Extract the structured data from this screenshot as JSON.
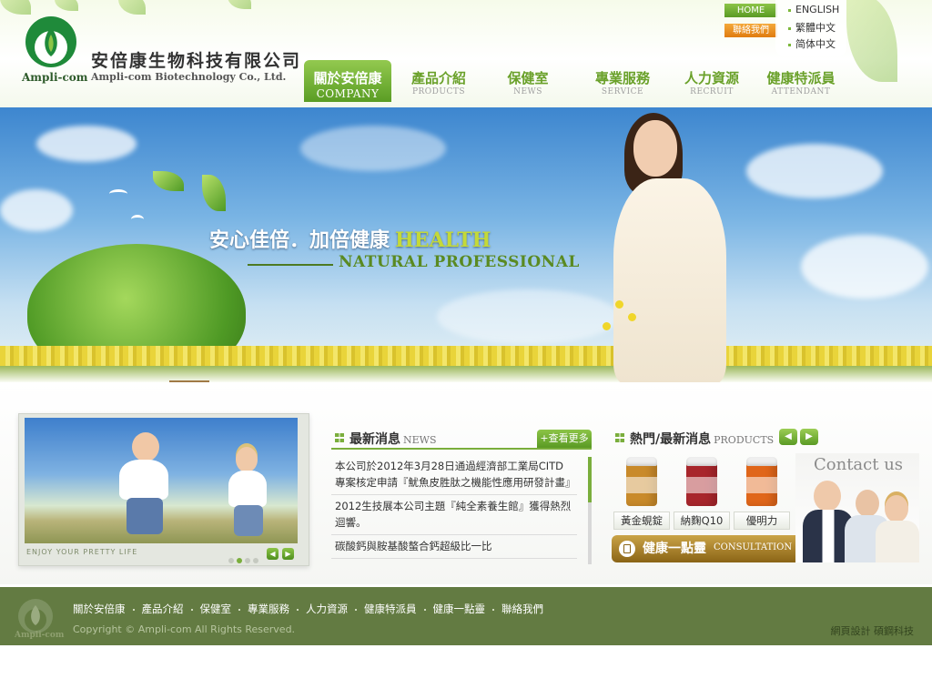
{
  "brand": {
    "logo_text": "Ampli-com",
    "company_zh": "安倍康生物科技有限公司",
    "company_en": "Ampli-com Biotechnology Co., Ltd."
  },
  "top_links": {
    "home": "HOME",
    "contact": "聯絡我們",
    "languages": [
      "ENGLISH",
      "繁體中文",
      "简体中文"
    ]
  },
  "nav": [
    {
      "zh": "關於安倍康",
      "en": "COMPANY",
      "active": true
    },
    {
      "zh": "產品介紹",
      "en": "PRODUCTS",
      "active": false
    },
    {
      "zh": "保健室",
      "en": "NEWS",
      "active": false
    },
    {
      "zh": "專業服務",
      "en": "SERVICE",
      "active": false
    },
    {
      "zh": "人力資源",
      "en": "RECRUIT",
      "active": false
    },
    {
      "zh": "健康特派員",
      "en": "ATTENDANT",
      "active": false
    }
  ],
  "banner": {
    "slogan_zh": "安心佳倍．加倍健康",
    "slogan_health": "HEALTH",
    "slogan_en": "NATURAL  PROFESSIONAL"
  },
  "slider": {
    "caption": "ENJOY YOUR PRETTY LIFE",
    "slide_count": 4,
    "active_slide": 2
  },
  "news": {
    "title_zh": "最新消息",
    "title_en": "NEWS",
    "more_label": "+查看更多",
    "items": [
      "本公司於2012年3月28日通過經濟部工業局CITD專案核定申請『魷魚皮胜肽之機能性應用研發計畫』",
      "2012生技展本公司主題『純全素養生館』獲得熱烈迴響。",
      "碳酸鈣與胺基酸螯合鈣超級比一比"
    ]
  },
  "products": {
    "title_zh": "熱門/最新消息",
    "title_en": "PRODUCTS",
    "items": [
      {
        "name": "黃金蜆錠",
        "color": "#c98a2a"
      },
      {
        "name": "納麴Q10",
        "color": "#a8262c"
      },
      {
        "name": "優明力",
        "color": "#e0661a"
      }
    ]
  },
  "consult": {
    "title_zh": "健康一點靈",
    "title_en": "CONSULTATION"
  },
  "contact": {
    "title": "Contact us"
  },
  "footer": {
    "logo_text": "Ampli-com",
    "nav": [
      "關於安倍康",
      "產品介紹",
      "保健室",
      "專業服務",
      "人力資源",
      "健康特派員",
      "健康一點靈",
      "聯絡我們"
    ],
    "copyright": "Copyright © Ampli-com All Rights Reserved.",
    "credit": "網頁設計  碩鋼科技"
  },
  "colors": {
    "brand_green": "#6aa12a",
    "footer_green": "#637b42",
    "accent_orange": "#e07b10",
    "consult_gold": "#a88228"
  }
}
